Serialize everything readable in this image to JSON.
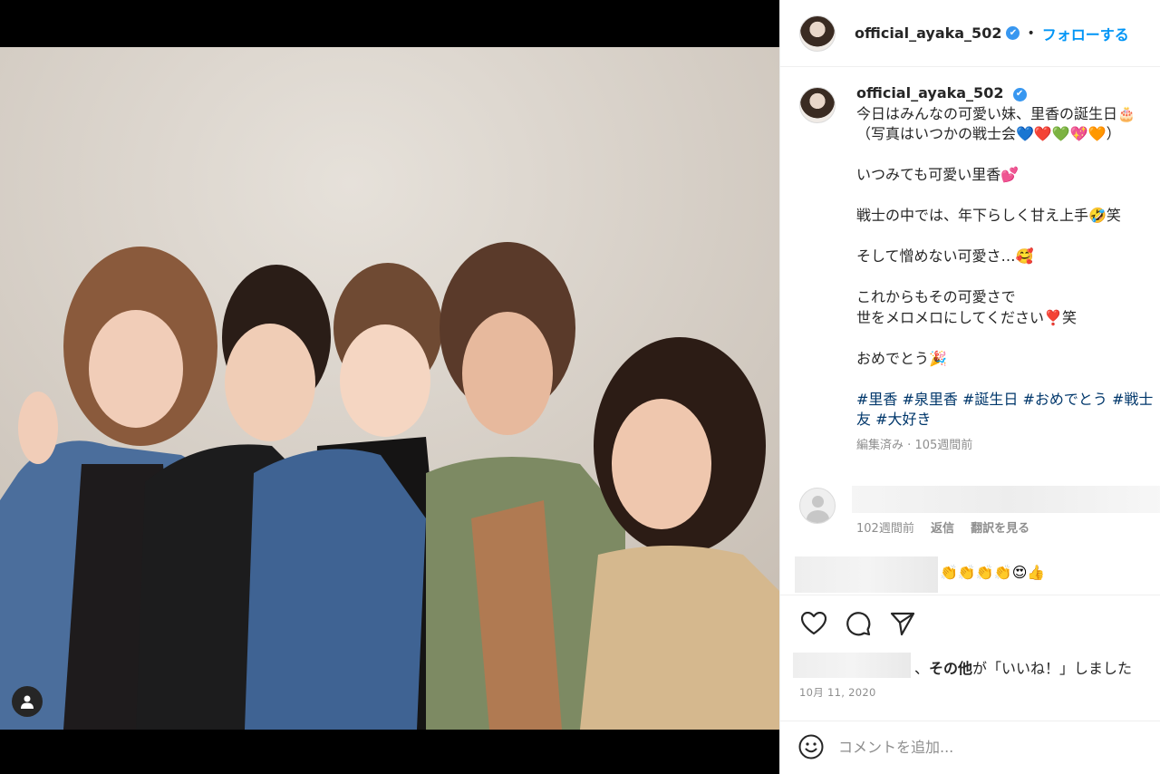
{
  "post": {
    "username": "official_ayaka_502",
    "follow_label": "フォローする",
    "dot": "•",
    "verified_icon": "✔"
  },
  "caption": {
    "username": "official_ayaka_502",
    "lines": [
      "今日はみんなの可愛い妹、里香の誕生日🎂",
      "（写真はいつかの戦士会💙❤️💚💖🧡）",
      "",
      "いつみても可愛い里香💕",
      "",
      "戦士の中では、年下らしく甘え上手🤣笑",
      "",
      "そして憎めない可愛さ…🥰",
      "",
      "これからもその可愛さで",
      "世をメロメロにしてください❣️笑",
      "",
      "おめでとう🎉"
    ],
    "hashtags_line1": "#里香 #泉里香 #誕生日 #おめでとう #戦士",
    "hashtags_line2": "友 #大好き",
    "edited": "編集済み",
    "sep": "·",
    "time": "105週間前"
  },
  "comment1": {
    "time": "102週間前",
    "reply": "返信",
    "translate": "翻訳を見る"
  },
  "comment2": {
    "text": "👏👏👏👏😍👍"
  },
  "likes": {
    "text": "、その他が「いいね！」しました",
    "strong": "その他"
  },
  "date": "10月 11, 2020",
  "add_comment": {
    "placeholder": "コメントを追加..."
  },
  "colors": {
    "accent": "#0095f6",
    "text": "#262626",
    "muted": "#8e8e8e",
    "hashtag": "#00376b"
  }
}
